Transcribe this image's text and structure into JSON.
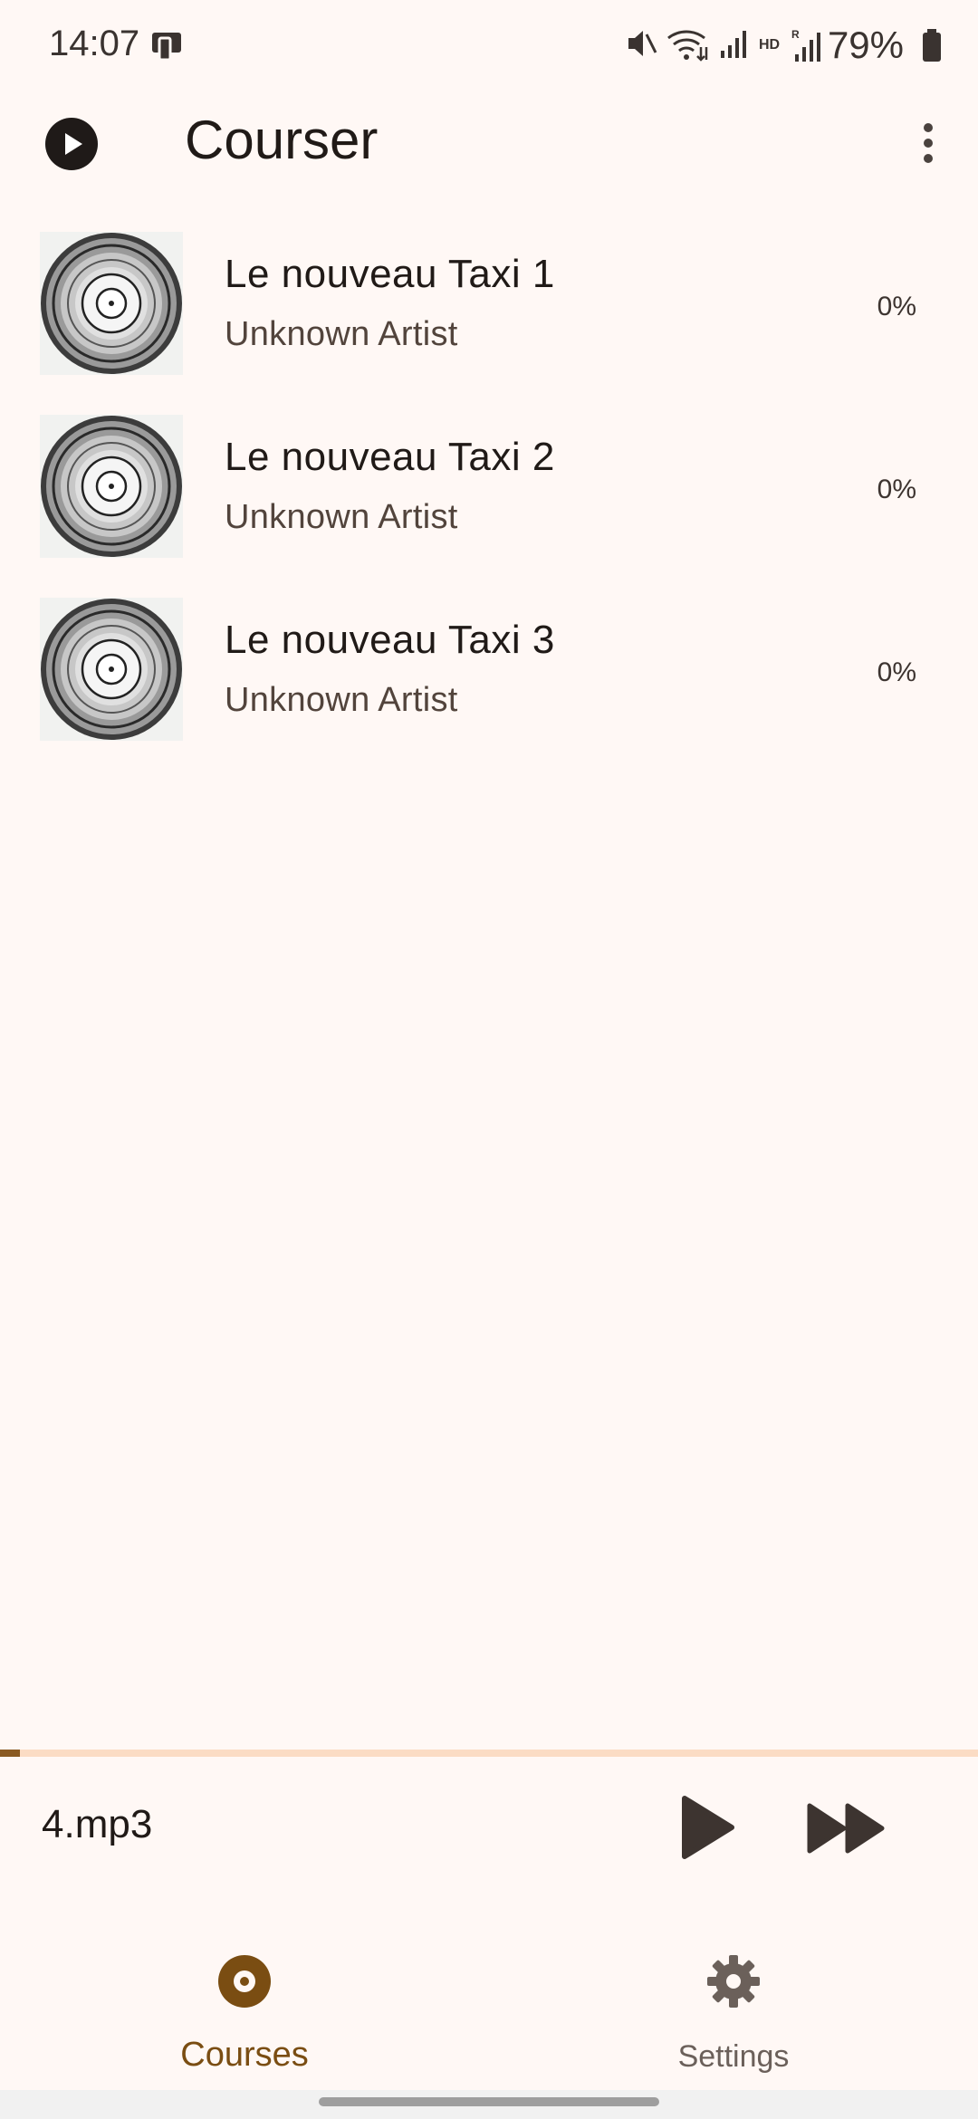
{
  "status_bar": {
    "time": "14:07",
    "battery_text": "79%",
    "icons": [
      "cast-device-icon",
      "mute-icon",
      "wifi-icon",
      "signal-icon",
      "hd-icon",
      "signal-roaming-icon",
      "battery-icon"
    ]
  },
  "app_bar": {
    "title": "Courser",
    "play_icon": "play-circle-icon",
    "menu_icon": "more-vert-icon"
  },
  "courses": [
    {
      "title": "Le nouveau Taxi 1",
      "artist": "Unknown Artist",
      "progress": "0%"
    },
    {
      "title": "Le nouveau Taxi 2",
      "artist": "Unknown Artist",
      "progress": "0%"
    },
    {
      "title": "Le nouveau Taxi 3",
      "artist": "Unknown Artist",
      "progress": "0%"
    }
  ],
  "player": {
    "file_name": "4.mp3",
    "progress_fraction": 0.02,
    "colors": {
      "track": "#fbdcc4",
      "fill": "#8a5a22"
    }
  },
  "bottom_nav": {
    "items": [
      {
        "label": "Courses",
        "icon": "disc-icon",
        "selected": true
      },
      {
        "label": "Settings",
        "icon": "gear-icon",
        "selected": false
      }
    ],
    "accent": "#7a4d12"
  }
}
